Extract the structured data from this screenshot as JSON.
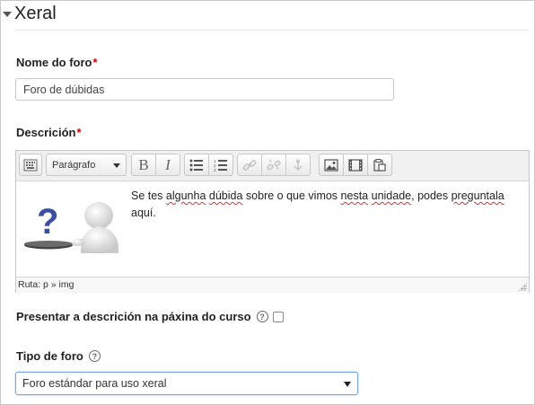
{
  "section": {
    "title": "Xeral"
  },
  "forum_name": {
    "label": "Nome do foro",
    "required_mark": "*",
    "value": "Foro de dúbidas"
  },
  "description": {
    "label": "Descrición",
    "required_mark": "*",
    "format_select": "Parágrafo",
    "content_text_1": "Se tes ",
    "content_spell_1": "algunha",
    "content_text_2": " ",
    "content_spell_2": "dúbida",
    "content_text_3": " sobre o que vimos ",
    "content_spell_3": "nesta",
    "content_text_4": " ",
    "content_spell_4": "unidade",
    "content_text_5": ", podes ",
    "content_spell_5": "preguntala",
    "content_text_6": " aquí.",
    "path": "Ruta: p » img"
  },
  "show_description": {
    "label": "Presentar a descrición na páxina do curso",
    "checked": false
  },
  "forum_type": {
    "label": "Tipo de foro",
    "selected": "Foro estándar para uso xeral"
  },
  "icons": [
    "collapse-triangle-icon",
    "toolbar-toggle-icon",
    "bold-icon",
    "italic-icon",
    "unordered-list-icon",
    "ordered-list-icon",
    "link-icon",
    "unlink-icon",
    "anchor-icon",
    "image-icon",
    "media-icon",
    "paste-icon",
    "help-icon",
    "resize-grip-icon"
  ]
}
